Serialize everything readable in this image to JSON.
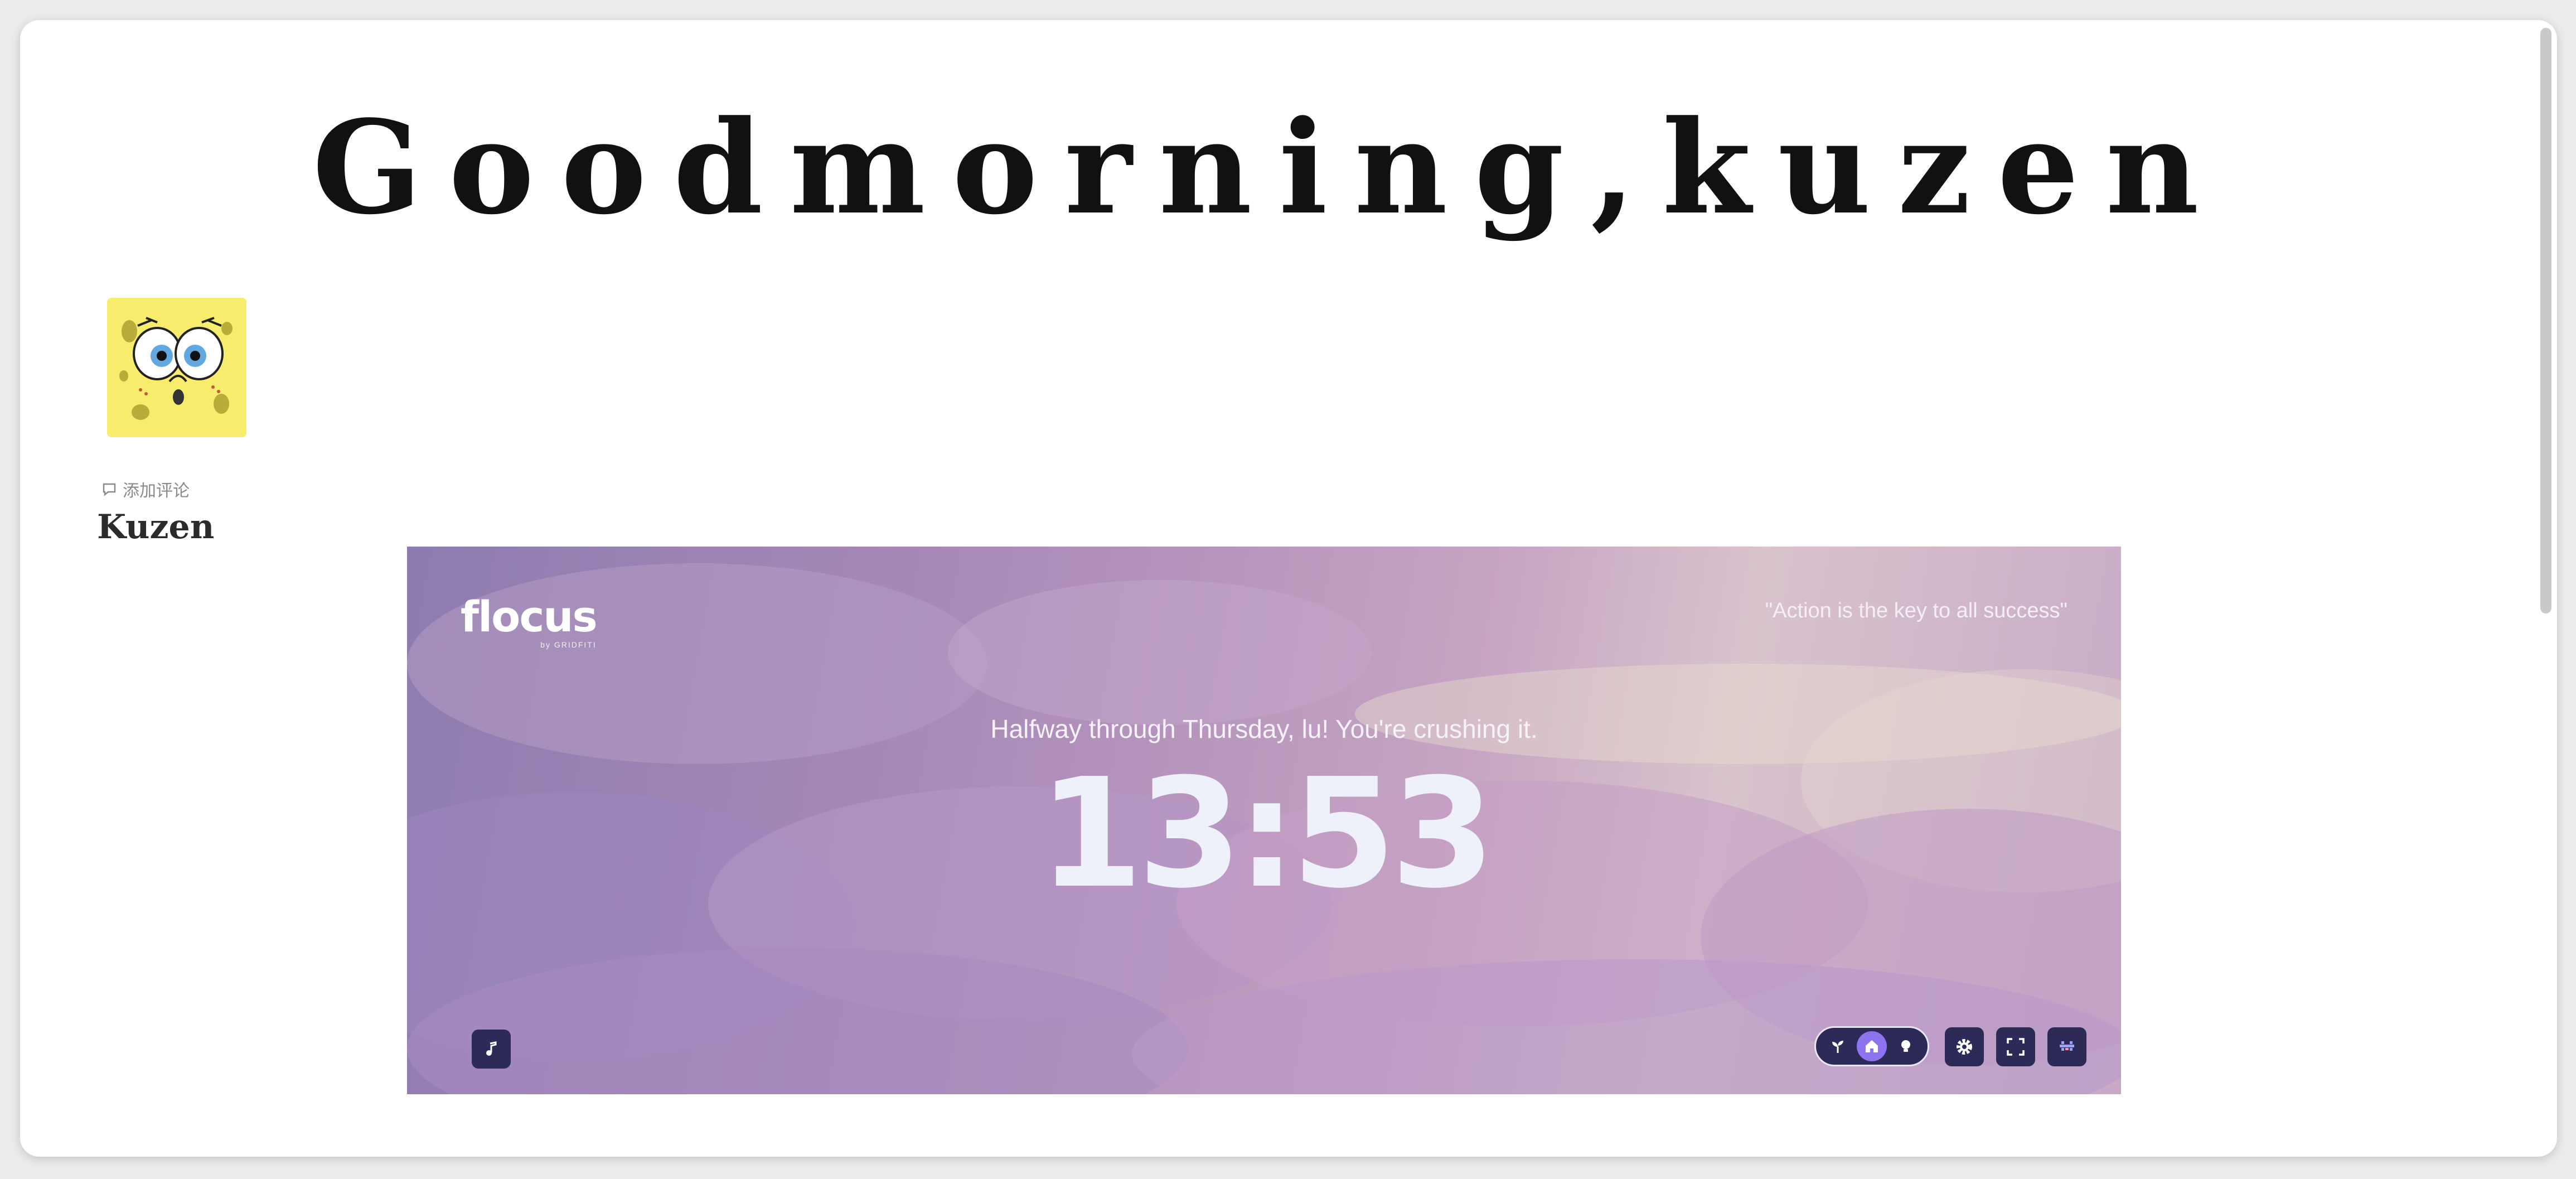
{
  "greeting": "Goodmorning,kuzen",
  "page": {
    "avatar_icon": "spongebob-face",
    "add_comment_label": "添加评论",
    "title": "Kuzen"
  },
  "flocus": {
    "brand": "flocus",
    "brand_sub": "by GRIDFITI",
    "quote": "\"Action is the key to all success\"",
    "subtitle": "Halfway through Thursday, lu! You're crushing it.",
    "time": "13:53",
    "controls": {
      "music_icon": "music-note-icon",
      "modes": [
        "sprout-icon",
        "home-icon",
        "lightbulb-icon"
      ],
      "active_mode": "home-icon",
      "settings_icon": "gear-icon",
      "fullscreen_icon": "fullscreen-icon",
      "extra_icon": "pixel-icon"
    },
    "colors": {
      "button_bg": "#2e2a57",
      "active_mode": "#8d73ee",
      "text": "#ffffff"
    }
  }
}
